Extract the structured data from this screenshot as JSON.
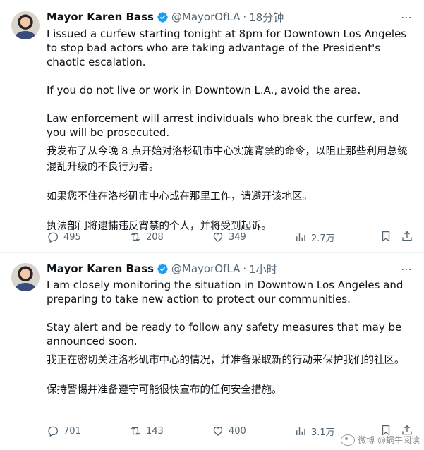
{
  "posts": [
    {
      "author_name": "Mayor Karen Bass",
      "handle": "@MayorOfLA",
      "separator": "·",
      "time": "18分钟",
      "more_icon": "more-icon",
      "body_en": [
        "I issued a curfew starting tonight at 8pm for Downtown Los Angeles to stop bad actors who are taking advantage of the President's chaotic escalation.",
        "If you do not live or work in Downtown L.A., avoid the area.",
        "Law enforcement will arrest individuals who break the curfew, and you will be prosecuted."
      ],
      "body_cn": [
        "我发布了从今晚 8 点开始对洛杉矶市中心实施宵禁的命令，以阻止那些利用总统混乱升级的不良行为者。",
        "如果您不住在洛杉矶市中心或在那里工作，请避开该地区。",
        "执法部门将逮捕违反宵禁的个人，并将受到起诉。"
      ],
      "replies": "495",
      "reposts": "208",
      "likes": "349",
      "views": "2.7万"
    },
    {
      "author_name": "Mayor Karen Bass",
      "handle": "@MayorOfLA",
      "separator": "·",
      "time": "1小时",
      "more_icon": "more-icon",
      "body_en": [
        "I am closely monitoring the situation in Downtown Los Angeles and preparing to take new action to protect our communities.",
        "Stay alert and be ready to follow any safety measures that may be announced soon."
      ],
      "body_cn": [
        "我正在密切关注洛杉矶市中心的情况，并准备采取新的行动来保护我们的社区。",
        "保持警惕并准备遵守可能很快宣布的任何安全措施。"
      ],
      "replies": "701",
      "reposts": "143",
      "likes": "400",
      "views": "3.1万"
    }
  ],
  "watermark": "微博 @蜗牛阅读",
  "colors": {
    "text": "#0f1419",
    "secondary": "#536471",
    "verified": "#1d9bf0",
    "divider": "#eff3f4"
  }
}
